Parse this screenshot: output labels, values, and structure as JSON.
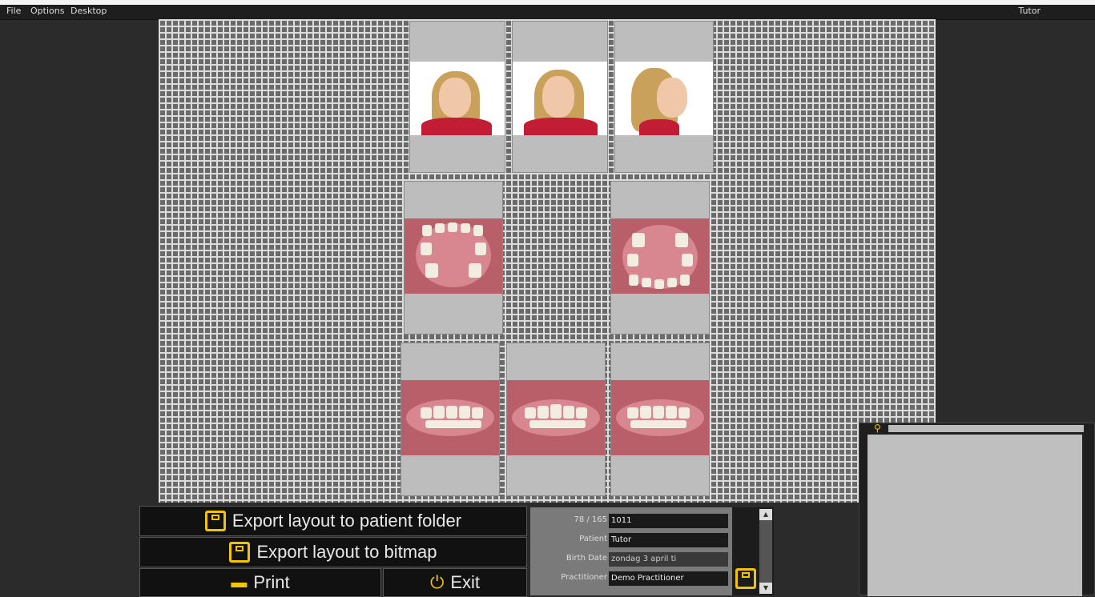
{
  "menu": {
    "items": [
      "File",
      "Options",
      "Desktop"
    ],
    "user": "Tutor"
  },
  "buttons": {
    "export_patient": "Export layout to patient folder",
    "export_bitmap": "Export layout to bitmap",
    "print": "Print",
    "exit": "Exit"
  },
  "patient": {
    "counter_label": "78 / 165",
    "counter_value": "1011",
    "patient_label": "Patient",
    "patient_value": "Tutor",
    "birth_label": "Birth Date",
    "birth_value": "zondag   3   april   ti",
    "practitioner_label": "Practitioner",
    "practitioner_value": "Demo Practitioner"
  },
  "icons": {
    "save": "floppy-disk-icon",
    "print": "printer-icon",
    "exit": "power-icon",
    "zoom": "magnifier-icon"
  },
  "colors": {
    "accent": "#f2c500",
    "grid_line": "#dcdcdc",
    "grid_bg": "#6a6a6a"
  }
}
